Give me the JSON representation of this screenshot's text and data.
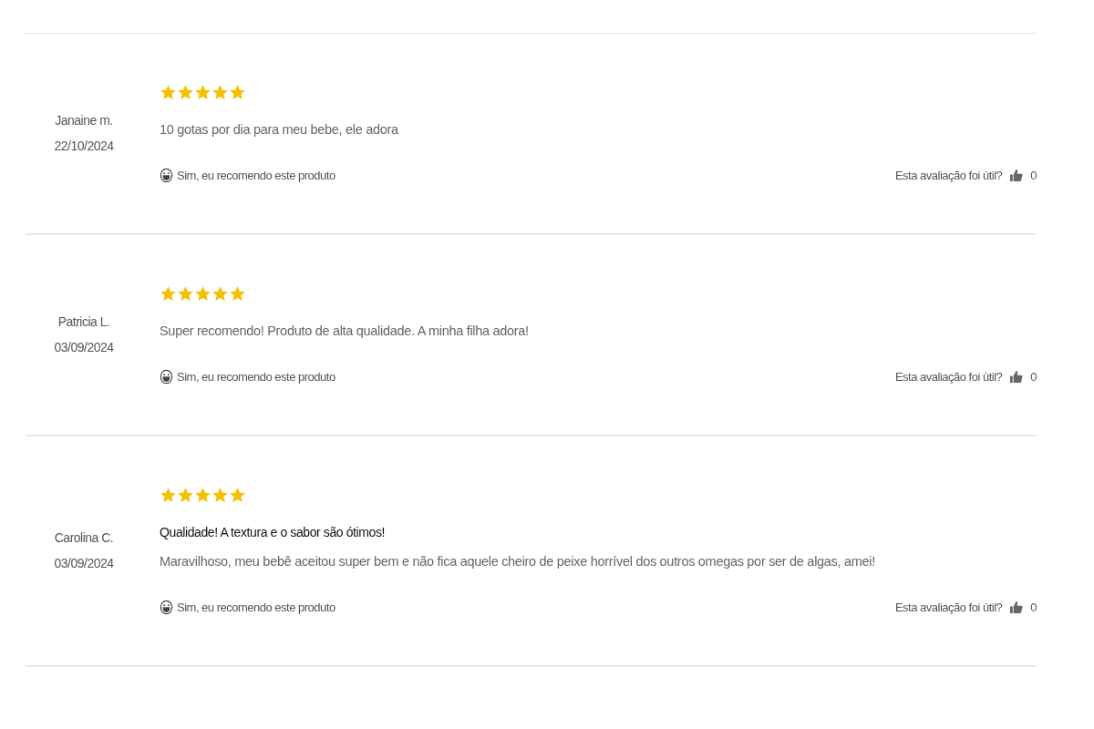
{
  "reviews": [
    {
      "author": "Janaine m.",
      "date": "22/10/2024",
      "stars": 5,
      "body": "10 gotas por dia para meu bebe, ele adora",
      "recommend": "Sim, eu recomendo este produto",
      "helpful_label": "Esta avaliação foi útil?",
      "helpful_count": "0"
    },
    {
      "author": "Patricia L.",
      "date": "03/09/2024",
      "stars": 5,
      "body": "Super recomendo! Produto de alta qualidade. A minha filha adora!",
      "recommend": "Sim, eu recomendo este produto",
      "helpful_label": "Esta avaliação foi útil?",
      "helpful_count": "0"
    },
    {
      "author": "Carolina C.",
      "date": "03/09/2024",
      "stars": 5,
      "title": "Qualidade! A textura e o sabor são ótimos!",
      "body": "Maravilhoso, meu bebê aceitou super bem e não fica aquele cheiro de peixe horrível dos outros omegas por ser de algas, amei!",
      "recommend": "Sim, eu recomendo este produto",
      "helpful_label": "Esta avaliação foi útil?",
      "helpful_count": "0"
    }
  ]
}
